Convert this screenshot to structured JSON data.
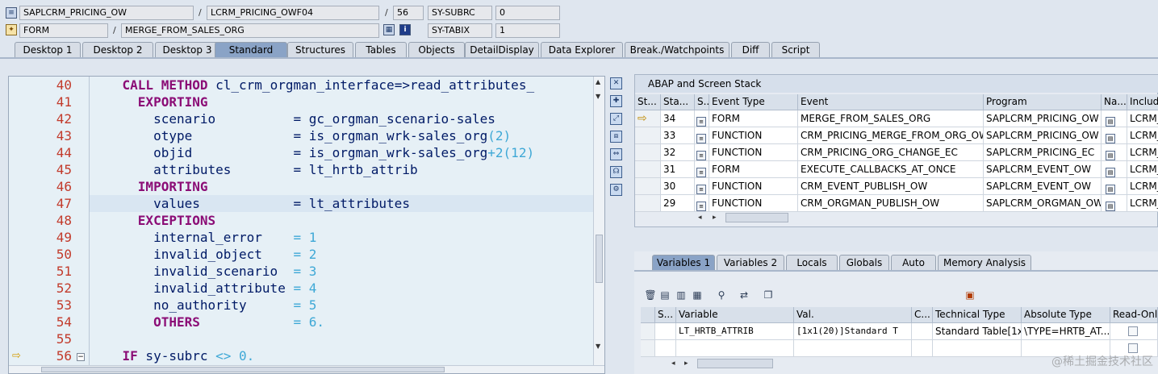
{
  "top": {
    "program": "SAPLCRM_PRICING_OW",
    "include": "LCRM_PRICING_OWF04",
    "line": "56",
    "subrc_label": "SY-SUBRC",
    "subrc_value": "0",
    "event_type": "FORM",
    "event_name": "MERGE_FROM_SALES_ORG",
    "tabix_label": "SY-TABIX",
    "tabix_value": "1",
    "slash": "/"
  },
  "tabs": [
    "Desktop 1",
    "Desktop 2",
    "Desktop 3",
    "Standard",
    "Structures",
    "Tables",
    "Objects",
    "DetailDisplay",
    "Data Explorer",
    "Break./Watchpoints",
    "Diff",
    "Script"
  ],
  "active_tab": "Standard",
  "code": {
    "lines": [
      {
        "n": "40",
        "text": "    CALL METHOD cl_crm_orgman_interface=>read_attributes_"
      },
      {
        "n": "41",
        "text": "      EXPORTING"
      },
      {
        "n": "42",
        "text": "        scenario          = gc_orgman_scenario-sales"
      },
      {
        "n": "43",
        "text": "        otype             = is_orgman_wrk-sales_org(2)"
      },
      {
        "n": "44",
        "text": "        objid             = is_orgman_wrk-sales_org+2(12)"
      },
      {
        "n": "45",
        "text": "        attributes        = lt_hrtb_attrib"
      },
      {
        "n": "46",
        "text": "      IMPORTING"
      },
      {
        "n": "47",
        "text": "        values            = lt_attributes"
      },
      {
        "n": "48",
        "text": "      EXCEPTIONS"
      },
      {
        "n": "49",
        "text": "        internal_error    = 1"
      },
      {
        "n": "50",
        "text": "        invalid_object    = 2"
      },
      {
        "n": "51",
        "text": "        invalid_scenario  = 3"
      },
      {
        "n": "52",
        "text": "        invalid_attribute = 4"
      },
      {
        "n": "53",
        "text": "        no_authority      = 5"
      },
      {
        "n": "54",
        "text": "        OTHERS            = 6."
      },
      {
        "n": "55",
        "text": ""
      },
      {
        "n": "56",
        "text": "    IF sy-subrc <> 0."
      }
    ]
  },
  "stack": {
    "title": "ABAP and Screen Stack",
    "headers": [
      "St...",
      "Sta...",
      "S...",
      "Event Type",
      "Event",
      "Program",
      "Na...",
      "Include"
    ],
    "rows": [
      {
        "st": "⇨",
        "sta": "34",
        "type": "FORM",
        "event": "MERGE_FROM_SALES_ORG",
        "program": "SAPLCRM_PRICING_OW",
        "include": "LCRM_I"
      },
      {
        "st": "",
        "sta": "33",
        "type": "FUNCTION",
        "event": "CRM_PRICING_MERGE_FROM_ORG_OW",
        "program": "SAPLCRM_PRICING_OW",
        "include": "LCRM_I"
      },
      {
        "st": "",
        "sta": "32",
        "type": "FUNCTION",
        "event": "CRM_PRICING_ORG_CHANGE_EC",
        "program": "SAPLCRM_PRICING_EC",
        "include": "LCRM_I"
      },
      {
        "st": "",
        "sta": "31",
        "type": "FORM",
        "event": "EXECUTE_CALLBACKS_AT_ONCE",
        "program": "SAPLCRM_EVENT_OW",
        "include": "LCRM_I"
      },
      {
        "st": "",
        "sta": "30",
        "type": "FUNCTION",
        "event": "CRM_EVENT_PUBLISH_OW",
        "program": "SAPLCRM_EVENT_OW",
        "include": "LCRM_I"
      },
      {
        "st": "",
        "sta": "29",
        "type": "FUNCTION",
        "event": "CRM_ORGMAN_PUBLISH_OW",
        "program": "SAPLCRM_ORGMAN_OW",
        "include": "LCRM_("
      }
    ]
  },
  "vartabs": [
    "Variables 1",
    "Variables 2",
    "Locals",
    "Globals",
    "Auto",
    "Memory Analysis"
  ],
  "active_vartab": "Variables 1",
  "vars": {
    "headers": [
      "S...",
      "Variable",
      "Val.",
      "C...",
      "Technical Type",
      "Absolute Type",
      "Read-Only"
    ],
    "rows": [
      {
        "variable": "LT_HRTB_ATTRIB",
        "value": "[1x1(20)]Standard T",
        "c": "",
        "tech": "Standard Table[1x...",
        "abs": "\\TYPE=HRTB_AT..."
      }
    ]
  },
  "watermark": "@稀土掘金技术社区"
}
